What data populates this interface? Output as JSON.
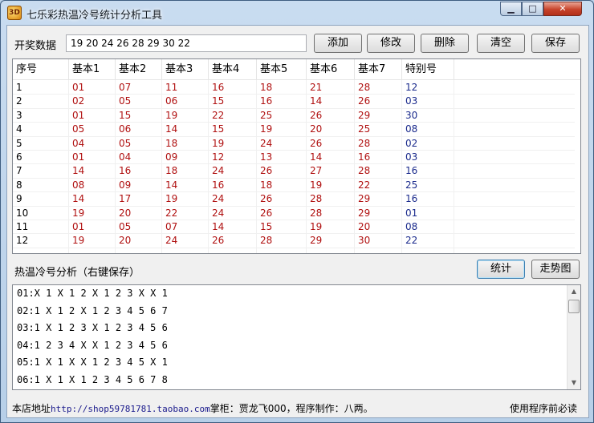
{
  "window": {
    "title": "七乐彩热温冷号统计分析工具",
    "icon_text": "3D"
  },
  "input": {
    "label": "开奖数据",
    "value": "19 20 24 26 28 29 30 22"
  },
  "toolbar": {
    "add": "添加",
    "edit": "修改",
    "delete": "删除",
    "clear": "清空",
    "save": "保存"
  },
  "table": {
    "columns": [
      "序号",
      "基本1",
      "基本2",
      "基本3",
      "基本4",
      "基本5",
      "基本6",
      "基本7",
      "特别号"
    ],
    "rows": [
      [
        "1",
        "01",
        "07",
        "11",
        "16",
        "18",
        "21",
        "28",
        "12"
      ],
      [
        "2",
        "02",
        "05",
        "06",
        "15",
        "16",
        "14",
        "26",
        "03"
      ],
      [
        "3",
        "01",
        "15",
        "19",
        "22",
        "25",
        "26",
        "29",
        "30"
      ],
      [
        "4",
        "05",
        "06",
        "14",
        "15",
        "19",
        "20",
        "25",
        "08"
      ],
      [
        "5",
        "04",
        "05",
        "18",
        "19",
        "24",
        "26",
        "28",
        "02"
      ],
      [
        "6",
        "01",
        "04",
        "09",
        "12",
        "13",
        "14",
        "16",
        "03"
      ],
      [
        "7",
        "14",
        "16",
        "18",
        "24",
        "26",
        "27",
        "28",
        "16"
      ],
      [
        "8",
        "08",
        "09",
        "14",
        "16",
        "18",
        "19",
        "22",
        "25"
      ],
      [
        "9",
        "14",
        "17",
        "19",
        "24",
        "26",
        "28",
        "29",
        "16"
      ],
      [
        "10",
        "19",
        "20",
        "22",
        "24",
        "26",
        "28",
        "29",
        "01"
      ],
      [
        "11",
        "01",
        "05",
        "07",
        "14",
        "15",
        "19",
        "20",
        "08"
      ],
      [
        "12",
        "19",
        "20",
        "24",
        "26",
        "28",
        "29",
        "30",
        "22"
      ]
    ]
  },
  "analysis": {
    "label": "热温冷号分析（右键保存）",
    "stats_button": "统计",
    "trend_button": "走势图",
    "lines": [
      "01:X 1 X 1 2 X 1 2 3 X X 1",
      "02:1 X 1 2 X 1 2 3 4 5 6 7",
      "03:1 X 1 2 3 X 1 2 3 4 5 6",
      "04:1 2 3 4 X X 1 2 3 4 5 6",
      "05:1 X 1 X X 1 2 3 4 5 X 1",
      "06:1 X 1 X 1 2 3 4 5 6 7 8"
    ]
  },
  "footer": {
    "prefix": "本店地址",
    "url": "http://shop59781781.taobao.com",
    "suffix": "掌柜：贾龙飞000，程序制作：八两。",
    "notice": "使用程序前必读"
  },
  "colors": {
    "basic_number": "#b01010",
    "special_number": "#1a2a8c"
  }
}
